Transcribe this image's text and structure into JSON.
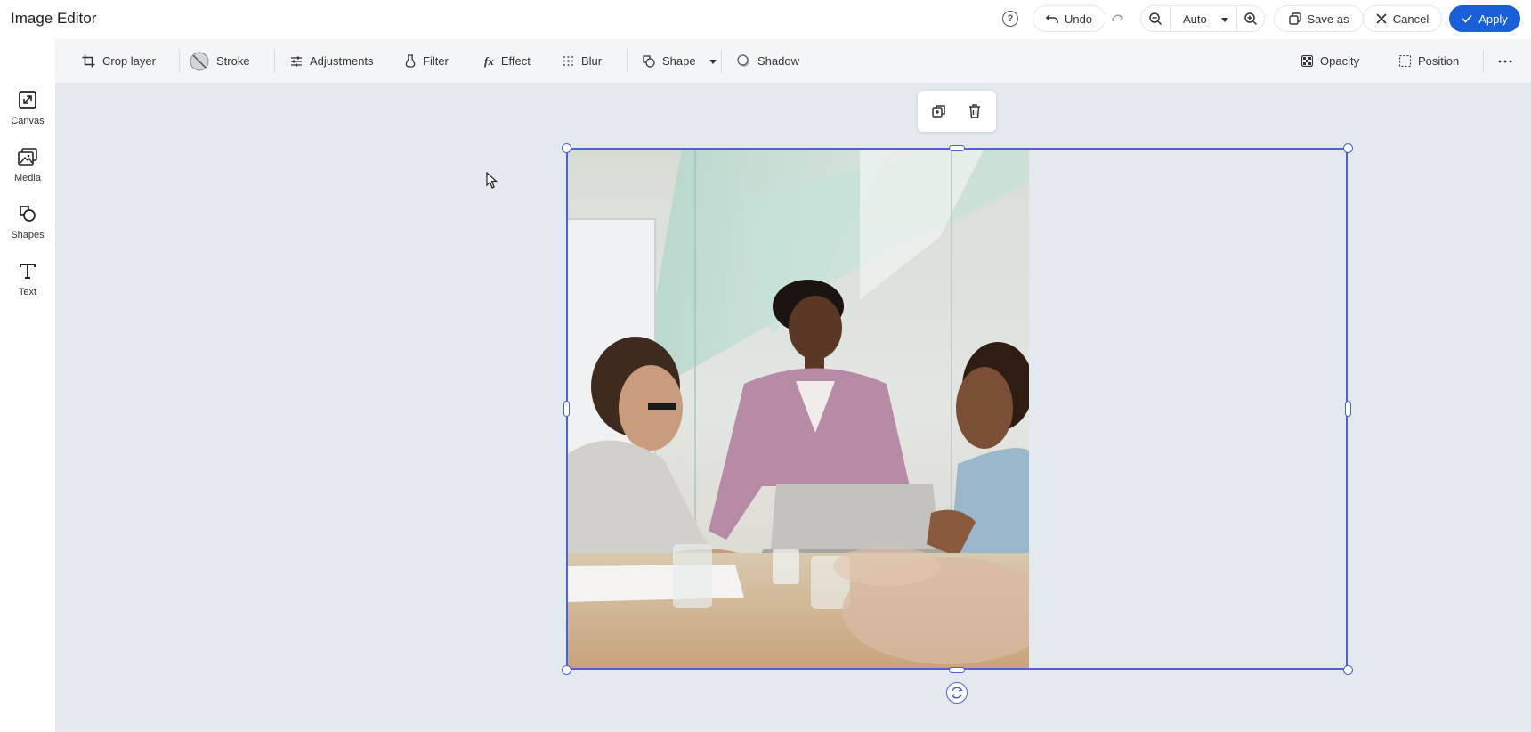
{
  "header": {
    "title": "Image Editor",
    "undo_label": "Undo",
    "zoom_value": "Auto",
    "save_as_label": "Save as",
    "cancel_label": "Cancel",
    "apply_label": "Apply"
  },
  "toolbar": {
    "items": [
      {
        "label": "Crop layer",
        "icon": "crop-icon"
      },
      {
        "label": "Stroke",
        "icon": "stroke-icon"
      },
      {
        "label": "Adjustments",
        "icon": "sliders-icon"
      },
      {
        "label": "Filter",
        "icon": "filter-icon"
      },
      {
        "label": "Effect",
        "icon": "fx-icon"
      },
      {
        "label": "Blur",
        "icon": "blur-icon"
      },
      {
        "label": "Shape",
        "icon": "shape-icon"
      },
      {
        "label": "Shadow",
        "icon": "shadow-icon"
      },
      {
        "label": "Opacity",
        "icon": "opacity-icon"
      },
      {
        "label": "Position",
        "icon": "position-icon"
      }
    ]
  },
  "sidebar": {
    "items": [
      {
        "label": "Canvas",
        "icon": "resize-icon"
      },
      {
        "label": "Media",
        "icon": "media-icon"
      },
      {
        "label": "Shapes",
        "icon": "shapes-icon"
      },
      {
        "label": "Text",
        "icon": "text-icon"
      }
    ]
  },
  "colors": {
    "accent": "#1a5fd8",
    "selection": "#4a62d4",
    "canvas_bg": "#e4e9ef",
    "toolbar_bg": "#f4f5f7"
  }
}
